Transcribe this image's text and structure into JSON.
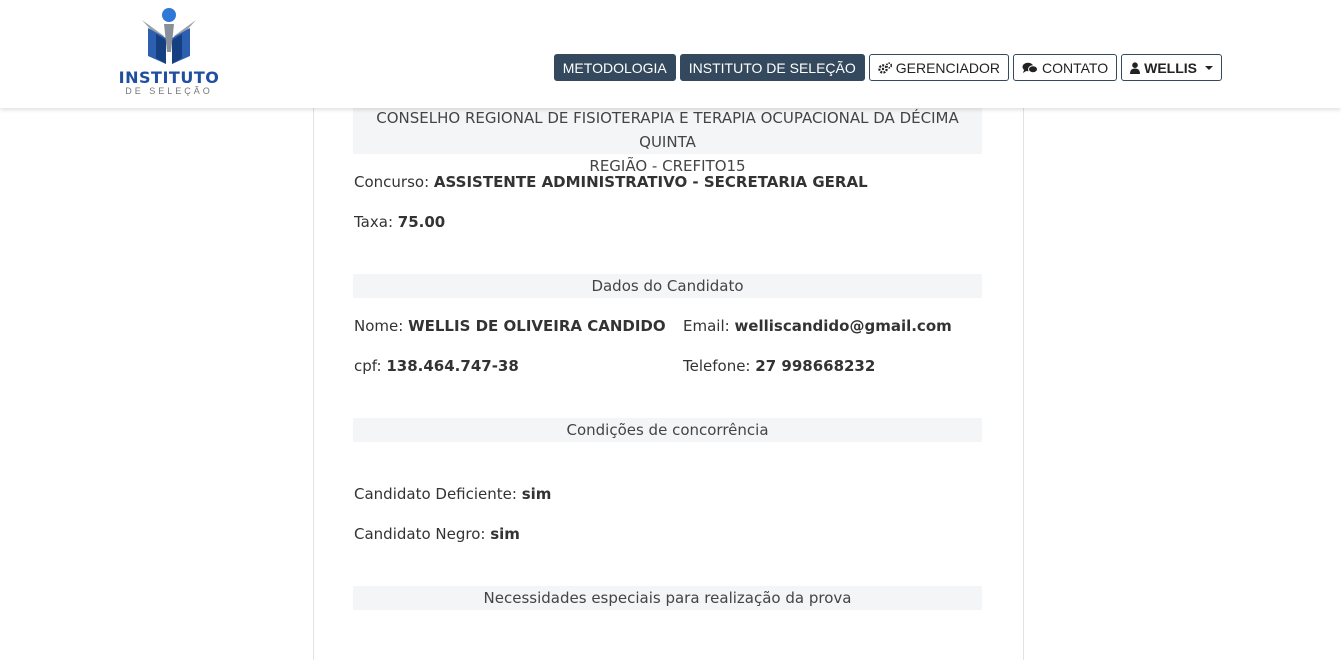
{
  "logo": {
    "title": "INSTITUTO",
    "subtitle": "DE SELEÇÃO"
  },
  "nav": {
    "metodologia": "METODOLOGIA",
    "instituto": "INSTITUTO DE SELEÇÃO",
    "gerenciador": "GERENCIADOR",
    "contato": "CONTATO",
    "user": "WELLIS"
  },
  "org": {
    "line1": "CONSELHO REGIONAL DE FISIOTERAPIA E TERAPIA OCUPACIONAL DA DÉCIMA QUINTA",
    "line2": "REGIÃO - CREFITO15"
  },
  "concurso": {
    "label": "Concurso:",
    "value": "ASSISTENTE ADMINISTRATIVO - SECRETARIA GERAL"
  },
  "taxa": {
    "label": "Taxa:",
    "value": "75.00"
  },
  "candidato": {
    "heading": "Dados do Candidato",
    "nome_label": "Nome:",
    "nome": "WELLIS DE OLIVEIRA CANDIDO",
    "email_label": "Email:",
    "email": "welliscandido@gmail.com",
    "cpf_label": "cpf:",
    "cpf": "138.464.747-38",
    "telefone_label": "Telefone:",
    "telefone": "27 998668232"
  },
  "condicoes": {
    "heading": "Condições de concorrência",
    "deficiente_label": "Candidato Deficiente:",
    "deficiente": "sim",
    "negro_label": "Candidato Negro:",
    "negro": "sim"
  },
  "necessidades": {
    "heading": "Necessidades especiais para realização da prova"
  },
  "colors": {
    "nav_dark": "#34495e",
    "section_bg": "#f4f5f7",
    "logo_blue": "#1f4fa0"
  }
}
